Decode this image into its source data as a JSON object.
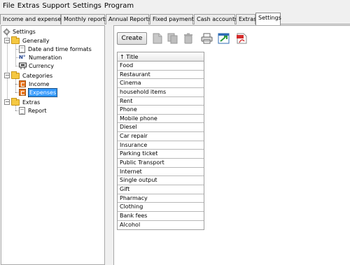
{
  "menubar": {
    "items": [
      "File",
      "Extras",
      "Support",
      "Settings",
      "Program"
    ]
  },
  "tabs": [
    {
      "label": "Income and expenses",
      "active": false
    },
    {
      "label": "Monthly reports",
      "active": false
    },
    {
      "label": "Annual Reports",
      "active": false
    },
    {
      "label": "Fixed payments",
      "active": false
    },
    {
      "label": "Cash accounts",
      "active": false
    },
    {
      "label": "Extras",
      "active": false
    },
    {
      "label": "Settings",
      "active": true
    }
  ],
  "tree": {
    "root": {
      "label": "Settings",
      "icon": "gear-icon"
    },
    "generally": {
      "label": "Generally",
      "children": [
        {
          "label": "Date and time formats",
          "icon": "document-icon"
        },
        {
          "label": "Numeration",
          "icon": "numero-icon"
        },
        {
          "label": "Currency",
          "icon": "currency-icon"
        }
      ]
    },
    "categories": {
      "label": "Categories",
      "children": [
        {
          "label": "Income",
          "icon": "category-icon"
        },
        {
          "label": "Expenses",
          "icon": "category-icon",
          "selected": true
        }
      ]
    },
    "extras": {
      "label": "Extras",
      "children": [
        {
          "label": "Report",
          "icon": "document-icon"
        }
      ]
    }
  },
  "toolbar": {
    "create_label": "Create",
    "icons": [
      "new-icon",
      "copy-icon",
      "delete-icon",
      "print-icon",
      "export-icon",
      "pdf-icon"
    ]
  },
  "grid": {
    "header": "↑ Title",
    "rows": [
      "Food",
      "Restaurant",
      "Cinema",
      "household items",
      "Rent",
      "Phone",
      "Mobile phone",
      "Diesel",
      "Car repair",
      "Insurance",
      "Parking ticket",
      "Public Transport",
      "Internet",
      "Single output",
      "Gift",
      "Pharmacy",
      "Clothing",
      "Bank fees",
      "Alcohol"
    ]
  },
  "colors": {
    "selection": "#3399ff",
    "folder": "#f5c842",
    "category_icon": "#e87722",
    "pdf_red": "#d42a2a"
  }
}
